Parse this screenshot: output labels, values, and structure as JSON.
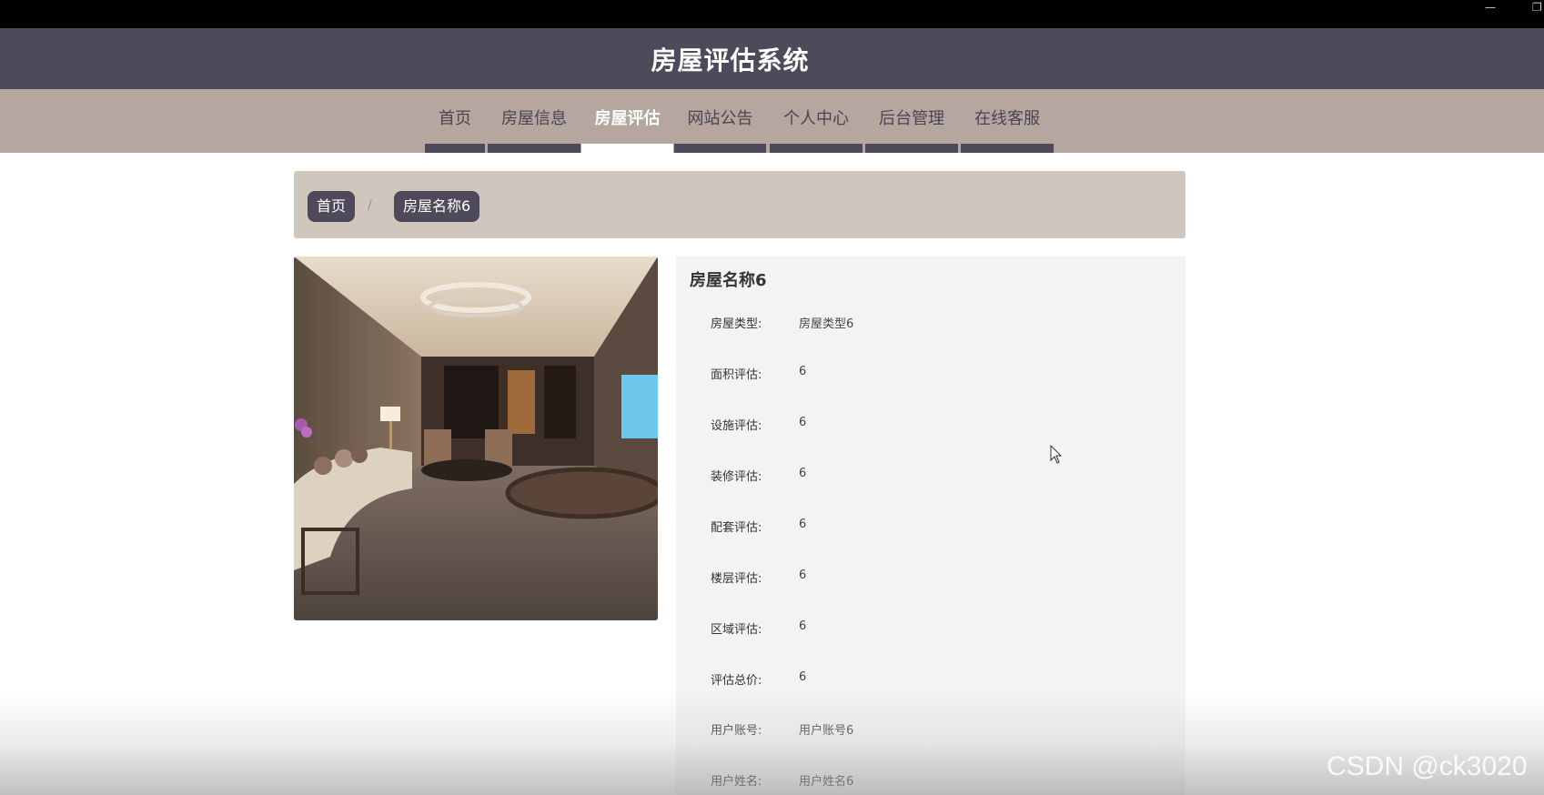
{
  "os": {
    "minimize": "—",
    "maximize": "❐"
  },
  "header": {
    "title": "房屋评估系统"
  },
  "nav": {
    "items": [
      {
        "label": "首页"
      },
      {
        "label": "房屋信息"
      },
      {
        "label": "房屋评估",
        "active": true
      },
      {
        "label": "网站公告"
      },
      {
        "label": "个人中心"
      },
      {
        "label": "后台管理"
      },
      {
        "label": "在线客服"
      }
    ]
  },
  "breadcrumb": {
    "home": "首页",
    "separator": "/",
    "current": "房屋名称6"
  },
  "detail": {
    "title": "房屋名称6",
    "fields": [
      {
        "label": "房屋类型:",
        "value": "房屋类型6"
      },
      {
        "label": "面积评估:",
        "value": "6"
      },
      {
        "label": "设施评估:",
        "value": "6"
      },
      {
        "label": "装修评估:",
        "value": "6"
      },
      {
        "label": "配套评估:",
        "value": "6"
      },
      {
        "label": "楼层评估:",
        "value": "6"
      },
      {
        "label": "区域评估:",
        "value": "6"
      },
      {
        "label": "评估总价:",
        "value": "6"
      },
      {
        "label": "用户账号:",
        "value": "用户账号6"
      },
      {
        "label": "用户姓名:",
        "value": "用户姓名6"
      }
    ]
  },
  "watermark": "CSDN @ck3020",
  "colors": {
    "header_bg": "#4f4a59",
    "nav_bg": "#b5a79f",
    "breadcrumb_bg": "#cfc6bd",
    "panel_bg": "#f3f3f3"
  }
}
